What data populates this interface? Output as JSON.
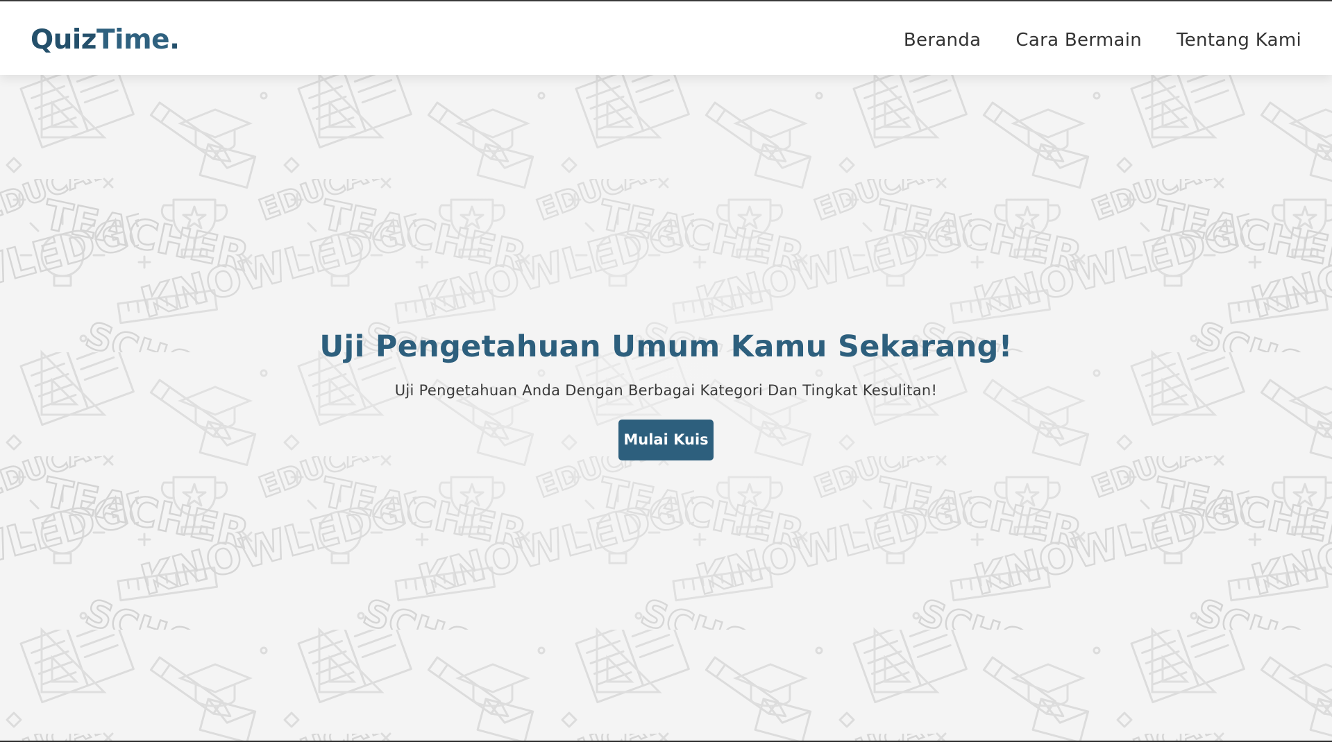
{
  "brand": {
    "name_part1": "Quiz",
    "name_part2": "Time",
    "name_dot": "."
  },
  "nav": {
    "items": [
      {
        "label": "Beranda"
      },
      {
        "label": "Cara Bermain"
      },
      {
        "label": "Tentang Kami"
      }
    ]
  },
  "hero": {
    "title": "Uji Pengetahuan Umum Kamu Sekarang!",
    "subtitle": "Uji Pengetahuan Anda Dengan Berbagai Kategori Dan Tingkat Kesulitan!",
    "button_label": "Mulai Kuis"
  },
  "colors": {
    "accent": "#2d5f7d",
    "pattern_stroke": "#d8d8d8",
    "background": "#f4f4f4"
  },
  "background_pattern": {
    "words": [
      "TEACHER",
      "SCHOOL",
      "KNOWLEDGE",
      "EDUCATION"
    ]
  }
}
